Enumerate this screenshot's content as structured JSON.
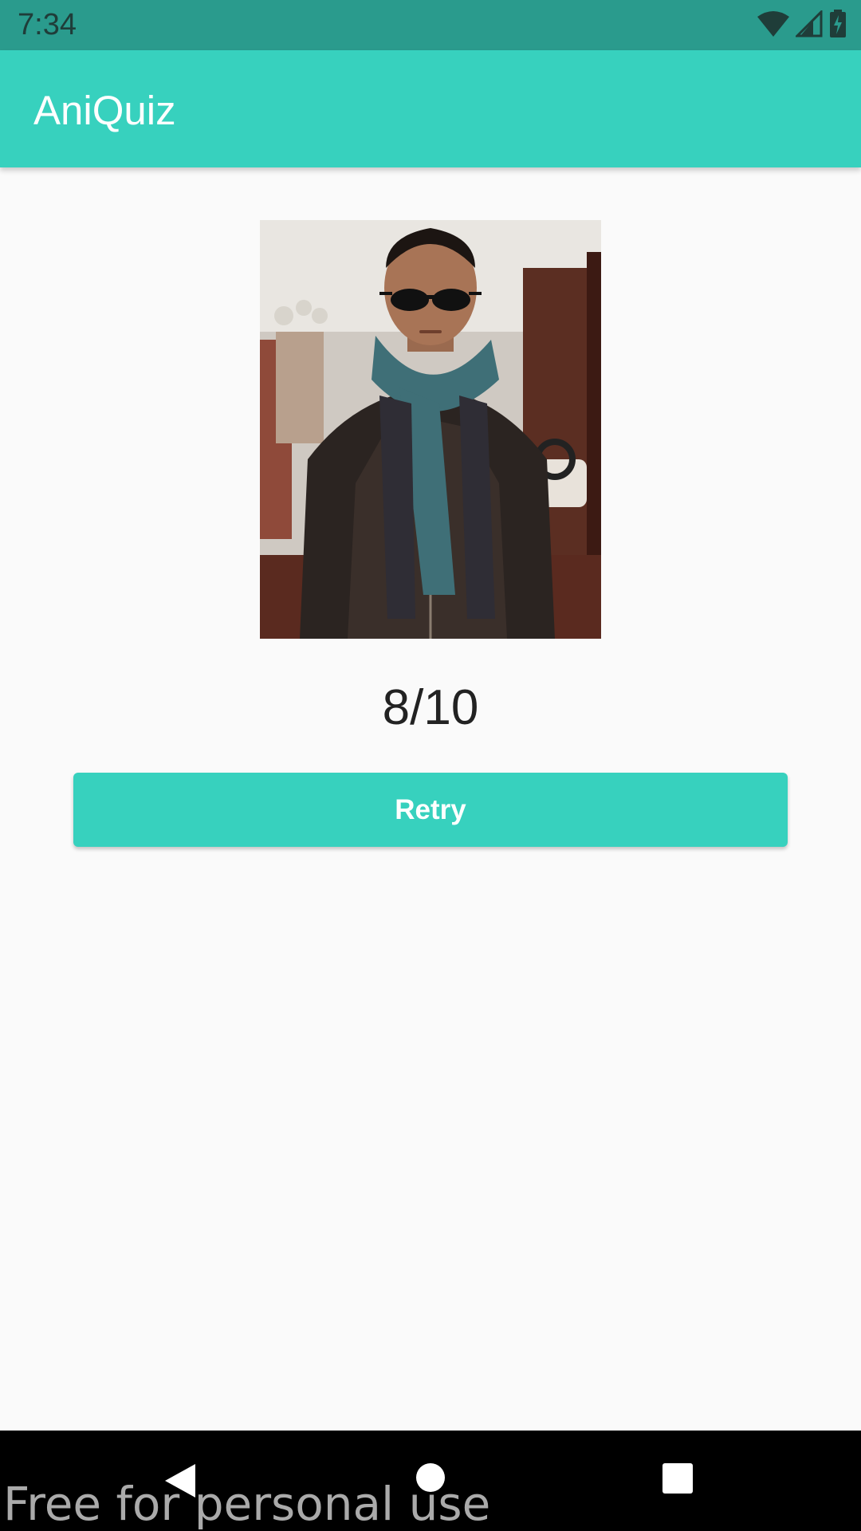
{
  "status_bar": {
    "time": "7:34",
    "icons": [
      "wifi-icon",
      "cellular-signal-icon",
      "battery-charging-icon"
    ]
  },
  "app_bar": {
    "title": "AniQuiz"
  },
  "result": {
    "photo_alt": "Man with sunglasses and scarf",
    "score": "8/10",
    "retry_label": "Retry"
  },
  "nav_bar": {
    "icons": [
      "back-icon",
      "home-icon",
      "recents-icon"
    ]
  },
  "watermark": {
    "text": "Free for personal use"
  },
  "colors": {
    "primary": "#37D1BE",
    "primary_dark": "#2A9B8D",
    "background": "#FAFAFA",
    "text": "#222222"
  }
}
